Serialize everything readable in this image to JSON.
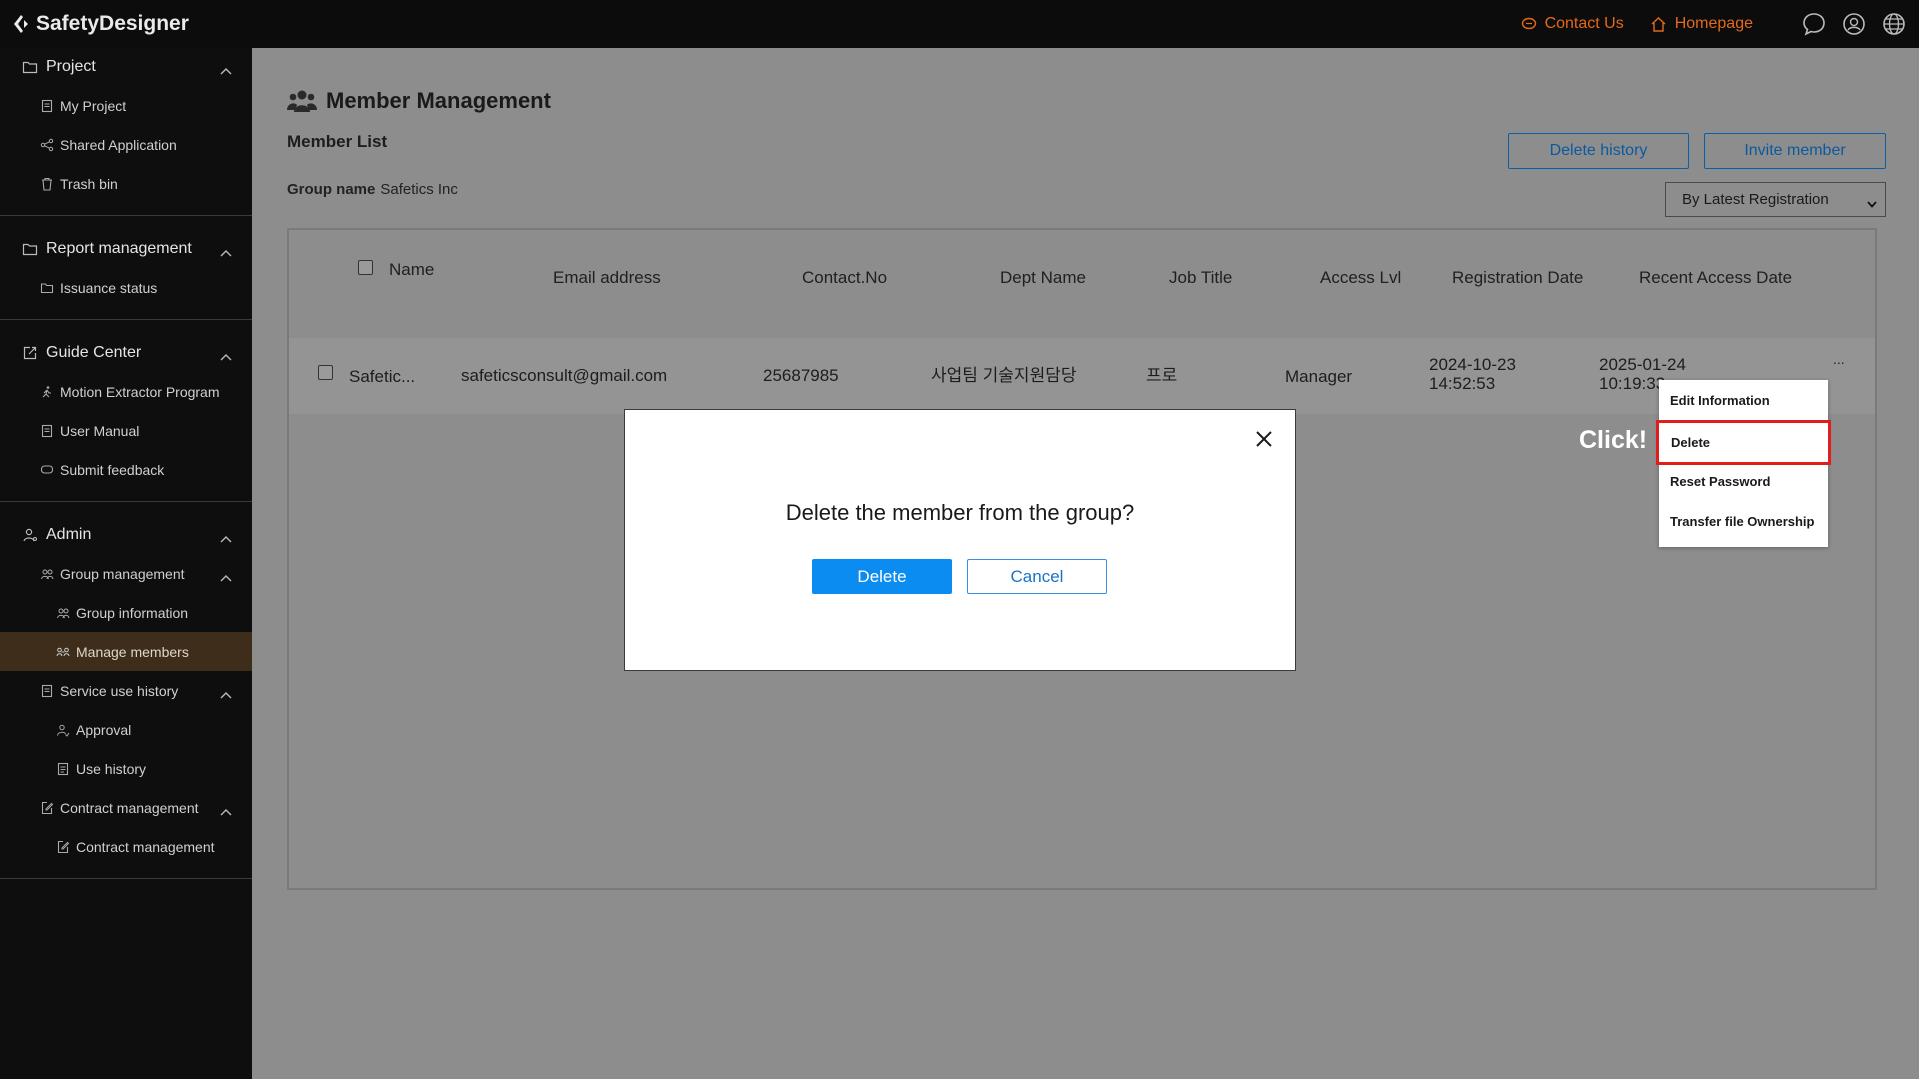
{
  "app": {
    "title": "SafetyDesigner"
  },
  "topbar": {
    "contact_label": "Contact Us",
    "homepage_label": "Homepage",
    "accent_color": "#e36a1b",
    "icons": [
      "chat-icon",
      "user-icon",
      "globe-icon"
    ]
  },
  "sidebar": {
    "project": {
      "label": "Project",
      "items": [
        "My Project",
        "Shared Application",
        "Trash bin"
      ]
    },
    "report": {
      "label": "Report management",
      "items": [
        "Issuance status"
      ]
    },
    "guide": {
      "label": "Guide Center",
      "items": [
        "Motion Extractor Program",
        "User Manual",
        "Submit feedback"
      ]
    },
    "admin": {
      "label": "Admin",
      "group_management": {
        "label": "Group management",
        "items": [
          "Group information",
          "Manage members"
        ]
      },
      "service_history": {
        "label": "Service use history",
        "items": [
          "Approval",
          "Use history"
        ]
      },
      "contract": {
        "label": "Contract management",
        "items": [
          "Contract management"
        ]
      }
    }
  },
  "main": {
    "title": "Member Management",
    "subtitle": "Member List",
    "group_label": "Group name",
    "group_value": "Safetics Inc",
    "delete_history_label": "Delete history",
    "invite_label": "Invite member",
    "sort_value": "By Latest Registration",
    "table": {
      "headers": [
        "Name",
        "Email address",
        "Contact.No",
        "Dept Name",
        "Job Title",
        "Access Lvl",
        "Registration Date",
        "Recent Access Date"
      ],
      "row": {
        "name": "Safetic...",
        "email": "safeticsconsult@gmail.com",
        "contact": "25687985",
        "dept": "사업팀 기술지원담당",
        "job": "프로",
        "access": "Manager",
        "reg_date": "2024-10-23",
        "reg_time": "14:52:53",
        "recent_date": "2025-01-24",
        "recent_time": "10:19:33",
        "more": "..."
      }
    }
  },
  "context_menu": {
    "items": [
      "Edit Information",
      "Delete",
      "Reset Password",
      "Transfer file Ownership"
    ],
    "highlight_color": "#e01e1e"
  },
  "annotation": {
    "click_label": "Click!"
  },
  "modal": {
    "message": "Delete the member from the group?",
    "confirm_label": "Delete",
    "cancel_label": "Cancel",
    "primary_color": "#0b8cf0"
  }
}
